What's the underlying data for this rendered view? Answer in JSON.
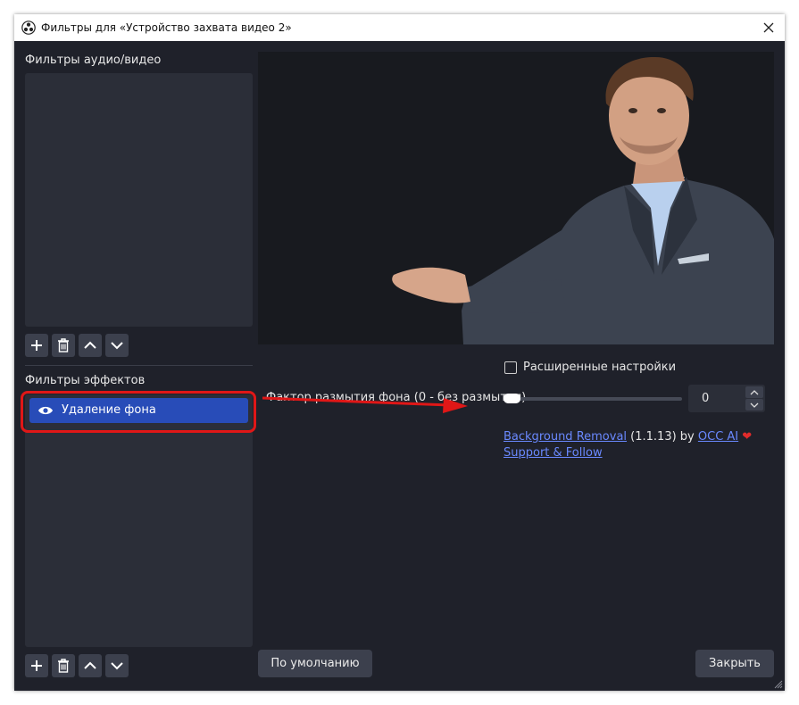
{
  "window": {
    "title": "Фильтры для «Устройство захвата видео 2»",
    "close_icon": "close-icon"
  },
  "audio_video": {
    "label": "Фильтры аудио/видео",
    "toolbar": [
      "add-icon",
      "trash-icon",
      "chevron-up-icon",
      "chevron-down-icon"
    ]
  },
  "effects": {
    "label": "Фильтры эффектов",
    "items": [
      {
        "label": "Удаление фона",
        "icon": "eye-icon",
        "selected": true
      }
    ],
    "toolbar": [
      "add-icon",
      "trash-icon",
      "chevron-up-icon",
      "chevron-down-icon"
    ]
  },
  "settings": {
    "advanced_label": "Расширенные настройки",
    "advanced_checked": false,
    "blur_label": "Фактор размытия фона (0 - без размытия)",
    "blur_value": "0",
    "plugin_name": "Background Removal",
    "plugin_version": "(1.1.13) by",
    "author": "OCC AI",
    "support": "Support & Follow"
  },
  "buttons": {
    "defaults": "По умолчанию",
    "close": "Закрыть"
  },
  "colors": {
    "background": "#1f212a",
    "panel": "#2b2e38",
    "button": "#3c404d",
    "selection": "#284cb8",
    "highlight": "#e01717",
    "link": "#6a89ff"
  }
}
